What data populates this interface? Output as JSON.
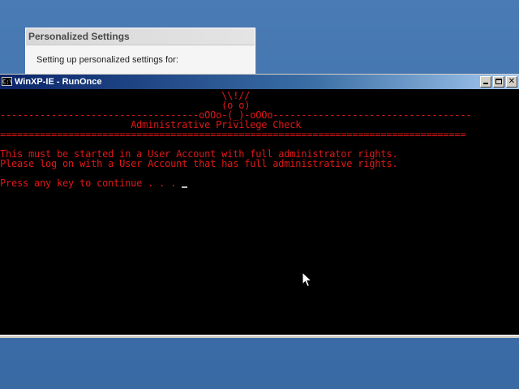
{
  "personalized_settings": {
    "title": "Personalized Settings",
    "message": "Setting up personalized settings for:"
  },
  "console_window": {
    "title": "WinXP-IE - RunOnce",
    "icon_label": "C:\\",
    "lines": {
      "art_1": "                                       \\\\!//",
      "art_2": "                                       (o o)",
      "art_3": "-----------------------------------oOOo-(_)-oOOo-----------------------------------",
      "heading": "                       Administrative Privilege Check",
      "separator": "==================================================================================",
      "blank_1": "",
      "message_1": "This must be started in a User Account with full administrator rights.",
      "message_2": "Please log on with a User Account that has full administrative rights.",
      "blank_2": "",
      "prompt": "Press any key to continue . . . "
    }
  },
  "colors": {
    "console_text": "#e01818",
    "console_background": "#000000",
    "desktop": "#3a6ea5"
  },
  "icons": {
    "console_icon": "console-icon",
    "minimize": "minimize-icon",
    "maximize": "maximize-icon",
    "close": "close-icon",
    "pointer": "mouse-pointer-icon"
  }
}
